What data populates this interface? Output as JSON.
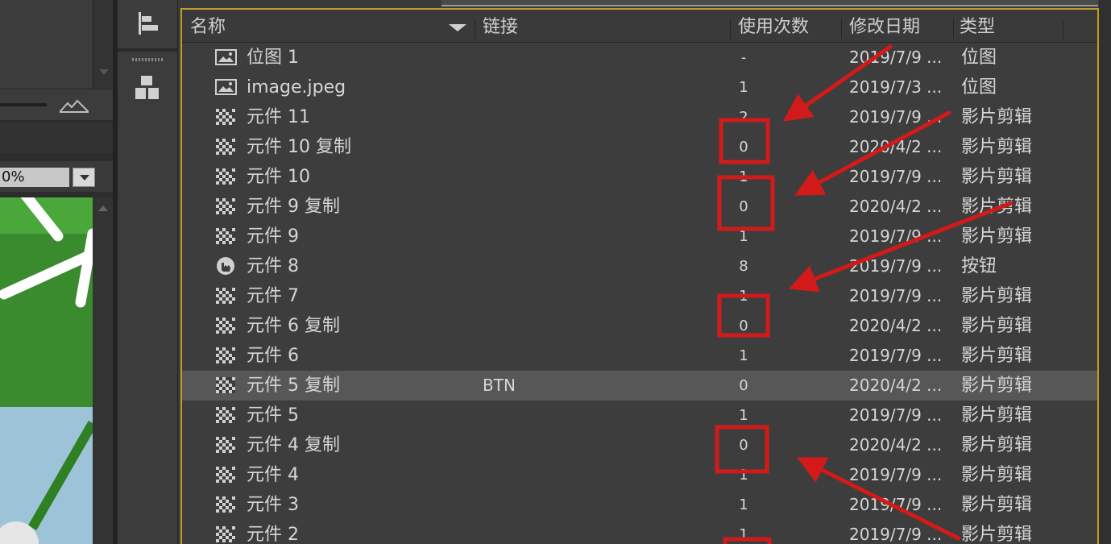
{
  "stage": {
    "zoom_value": "0%"
  },
  "library": {
    "columns": {
      "name": "名称",
      "linkage": "链接",
      "use_count": "使用次数",
      "date_modified": "修改日期",
      "type": "类型"
    },
    "items": [
      {
        "name": "位图 1",
        "linkage": "",
        "use_count": "-",
        "date_modified": "2019/7/9 ...",
        "type": "位图",
        "icon": "bitmap-icon",
        "selected": false
      },
      {
        "name": "image.jpeg",
        "linkage": "",
        "use_count": "1",
        "date_modified": "2019/7/3 ...",
        "type": "位图",
        "icon": "bitmap-icon",
        "selected": false
      },
      {
        "name": "元件 11",
        "linkage": "",
        "use_count": "2",
        "date_modified": "2019/7/9 ...",
        "type": "影片剪辑",
        "icon": "movieclip-icon",
        "selected": false
      },
      {
        "name": "元件 10 复制",
        "linkage": "",
        "use_count": "0",
        "date_modified": "2020/4/2 ...",
        "type": "影片剪辑",
        "icon": "movieclip-icon",
        "selected": false
      },
      {
        "name": "元件 10",
        "linkage": "",
        "use_count": "1",
        "date_modified": "2019/7/9 ...",
        "type": "影片剪辑",
        "icon": "movieclip-icon",
        "selected": false
      },
      {
        "name": "元件 9 复制",
        "linkage": "",
        "use_count": "0",
        "date_modified": "2020/4/2 ...",
        "type": "影片剪辑",
        "icon": "movieclip-icon",
        "selected": false
      },
      {
        "name": "元件 9",
        "linkage": "",
        "use_count": "1",
        "date_modified": "2019/7/9 ...",
        "type": "影片剪辑",
        "icon": "movieclip-icon",
        "selected": false
      },
      {
        "name": "元件 8",
        "linkage": "",
        "use_count": "8",
        "date_modified": "2019/7/9 ...",
        "type": "按钮",
        "icon": "button-symbol-icon",
        "selected": false
      },
      {
        "name": "元件 7",
        "linkage": "",
        "use_count": "1",
        "date_modified": "2019/7/9 ...",
        "type": "影片剪辑",
        "icon": "movieclip-icon",
        "selected": false
      },
      {
        "name": "元件 6 复制",
        "linkage": "",
        "use_count": "0",
        "date_modified": "2020/4/2 ...",
        "type": "影片剪辑",
        "icon": "movieclip-icon",
        "selected": false
      },
      {
        "name": "元件 6",
        "linkage": "",
        "use_count": "1",
        "date_modified": "2019/7/9 ...",
        "type": "影片剪辑",
        "icon": "movieclip-icon",
        "selected": false
      },
      {
        "name": "元件 5 复制",
        "linkage": "BTN",
        "use_count": "0",
        "date_modified": "2020/4/2 ...",
        "type": "影片剪辑",
        "icon": "movieclip-icon",
        "selected": true
      },
      {
        "name": "元件 5",
        "linkage": "",
        "use_count": "1",
        "date_modified": "2019/7/9 ...",
        "type": "影片剪辑",
        "icon": "movieclip-icon",
        "selected": false
      },
      {
        "name": "元件 4 复制",
        "linkage": "",
        "use_count": "0",
        "date_modified": "2020/4/2 ...",
        "type": "影片剪辑",
        "icon": "movieclip-icon",
        "selected": false
      },
      {
        "name": "元件 4",
        "linkage": "",
        "use_count": "1",
        "date_modified": "2019/7/9 ...",
        "type": "影片剪辑",
        "icon": "movieclip-icon",
        "selected": false
      },
      {
        "name": "元件 3",
        "linkage": "",
        "use_count": "1",
        "date_modified": "2019/7/9 ...",
        "type": "影片剪辑",
        "icon": "movieclip-icon",
        "selected": false
      },
      {
        "name": "元件 2",
        "linkage": "",
        "use_count": "1",
        "date_modified": "2019/7/9 ...",
        "type": "影片剪辑",
        "icon": "movieclip-icon",
        "selected": false
      }
    ]
  },
  "annotations": {
    "color": "#d21a1a"
  },
  "colors": {
    "panel_border": "#c49a2c",
    "panel_bg": "#3d3d3d",
    "selected_row": "#575757"
  }
}
